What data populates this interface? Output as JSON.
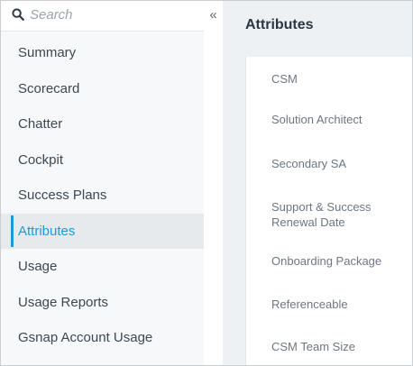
{
  "search": {
    "placeholder": "Search"
  },
  "sidebar": {
    "collapse_label": "«",
    "items": [
      {
        "label": "Summary",
        "active": false
      },
      {
        "label": "Scorecard",
        "active": false
      },
      {
        "label": "Chatter",
        "active": false
      },
      {
        "label": "Cockpit",
        "active": false
      },
      {
        "label": "Success Plans",
        "active": false
      },
      {
        "label": "Attributes",
        "active": true
      },
      {
        "label": "Usage",
        "active": false
      },
      {
        "label": "Usage Reports",
        "active": false
      },
      {
        "label": "Gsnap Account Usage",
        "active": false
      }
    ]
  },
  "main": {
    "title": "Attributes",
    "attributes": [
      {
        "label": "CSM"
      },
      {
        "label": "Solution Architect"
      },
      {
        "label": "Secondary SA"
      },
      {
        "label": "Support & Success Renewal Date"
      },
      {
        "label": "Onboarding Package"
      },
      {
        "label": "Referenceable"
      },
      {
        "label": "CSM Team Size"
      }
    ]
  },
  "colors": {
    "accent": "#1c9ad6",
    "nav_bg": "#f6f8f9",
    "main_bg": "#eef1f3",
    "text": "#3c4852",
    "muted": "#6c7780"
  }
}
